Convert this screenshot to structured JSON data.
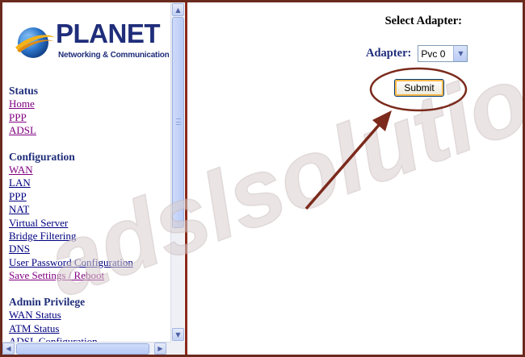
{
  "brand": {
    "name": "PLANET",
    "tagline": "Networking & Communication",
    "colors": {
      "navy": "#1f2d7a",
      "accent_red": "#8a2a1a",
      "globe_blue": "#2a73c8",
      "globe_gold": "#f3b21a"
    }
  },
  "watermark": {
    "text": "adslsolution"
  },
  "sidebar": {
    "sections": [
      {
        "heading": "Status",
        "links": [
          {
            "label": "Home",
            "visited": true
          },
          {
            "label": "PPP",
            "visited": true
          },
          {
            "label": "ADSL",
            "visited": true
          }
        ]
      },
      {
        "heading": "Configuration",
        "links": [
          {
            "label": "WAN",
            "visited": true
          },
          {
            "label": "LAN",
            "visited": false
          },
          {
            "label": "PPP",
            "visited": false
          },
          {
            "label": "NAT",
            "visited": false
          },
          {
            "label": "Virtual Server",
            "visited": false
          },
          {
            "label": "Bridge Filtering",
            "visited": false
          },
          {
            "label": "DNS",
            "visited": false
          },
          {
            "label": "User Password Configuration",
            "visited": false
          },
          {
            "label": "Save Settings / Reboot",
            "visited": true
          }
        ]
      },
      {
        "heading": "Admin Privilege",
        "links": [
          {
            "label": "WAN Status",
            "visited": false
          },
          {
            "label": "ATM Status",
            "visited": false
          },
          {
            "label": "ADSL Configuration",
            "visited": false
          }
        ]
      }
    ]
  },
  "main": {
    "title": "Select Adapter:",
    "adapter_label": "Adapter:",
    "adapter_value": "Pvc 0",
    "submit_label": "Submit"
  },
  "icons": {
    "scroll_up": "scroll-up-arrow-icon",
    "scroll_down": "scroll-down-arrow-icon",
    "scroll_left": "scroll-left-arrow-icon",
    "scroll_right": "scroll-right-arrow-icon",
    "dropdown": "chevron-down-icon"
  }
}
